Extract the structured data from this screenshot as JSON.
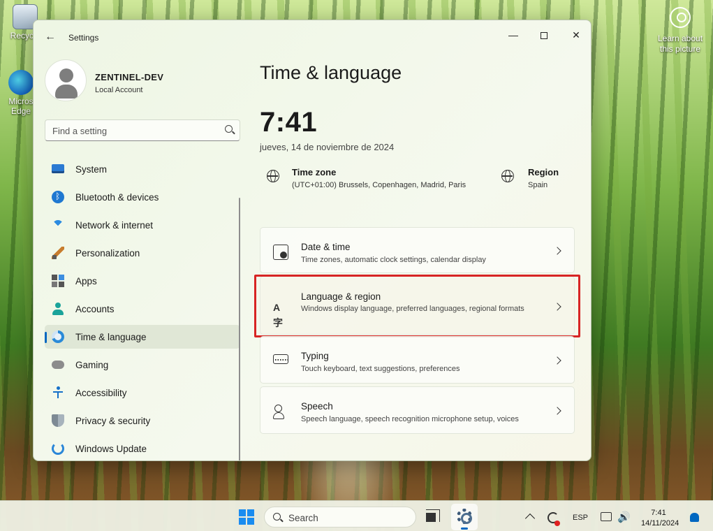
{
  "desktop": {
    "recycle_label": "Recycle",
    "edge_label": "Micros Edge",
    "learn_label": "Learn about this picture"
  },
  "window": {
    "title": "Settings",
    "back_glyph": "←",
    "minimize_glyph": "—",
    "close_glyph": "✕"
  },
  "account": {
    "name": "ZENTINEL-DEV",
    "type": "Local Account"
  },
  "search": {
    "placeholder": "Find a setting"
  },
  "nav": {
    "items": [
      {
        "label": "System",
        "icon": "monitor-icon"
      },
      {
        "label": "Bluetooth & devices",
        "icon": "bluetooth-icon"
      },
      {
        "label": "Network & internet",
        "icon": "wifi-icon"
      },
      {
        "label": "Personalization",
        "icon": "brush-icon"
      },
      {
        "label": "Apps",
        "icon": "apps-icon"
      },
      {
        "label": "Accounts",
        "icon": "person-icon"
      },
      {
        "label": "Time & language",
        "icon": "clock-globe-icon",
        "selected": true
      },
      {
        "label": "Gaming",
        "icon": "gamepad-icon"
      },
      {
        "label": "Accessibility",
        "icon": "accessibility-icon"
      },
      {
        "label": "Privacy & security",
        "icon": "shield-icon"
      },
      {
        "label": "Windows Update",
        "icon": "update-icon"
      }
    ]
  },
  "main": {
    "title": "Time & language",
    "clock": "7:41",
    "date": "jueves, 14 de noviembre de 2024",
    "timezone": {
      "title": "Time zone",
      "value": "(UTC+01:00) Brussels, Copenhagen, Madrid, Paris"
    },
    "region": {
      "title": "Region",
      "value": "Spain"
    },
    "cards": [
      {
        "title": "Date & time",
        "subtitle": "Time zones, automatic clock settings, calendar display",
        "icon": "calendar-clock-icon"
      },
      {
        "title": "Language & region",
        "subtitle": "Windows display language, preferred languages, regional formats",
        "icon": "language-icon",
        "icon_glyph": "A字",
        "highlighted": true,
        "highlight_color": "#d72424"
      },
      {
        "title": "Typing",
        "subtitle": "Touch keyboard, text suggestions, preferences",
        "icon": "keyboard-icon"
      },
      {
        "title": "Speech",
        "subtitle": "Speech language, speech recognition microphone setup, voices",
        "icon": "speech-icon"
      }
    ]
  },
  "taskbar": {
    "search_placeholder": "Search",
    "language": "ESP",
    "volume_glyph": "🔊",
    "time": "7:41",
    "date": "14/11/2024"
  },
  "colors": {
    "accent": "#0067c0",
    "highlight": "#d72424"
  }
}
